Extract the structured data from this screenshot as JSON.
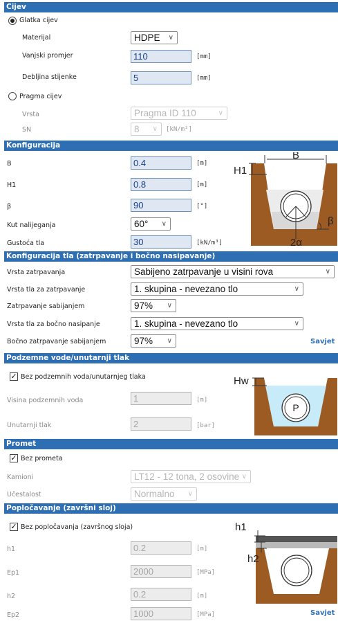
{
  "sections": {
    "cijev": "Cijev",
    "konfiguracija": "Konfiguracija",
    "konfiguracija_tla": "Konfiguracija tla (zatrpavanje i bočno nasipavanje)",
    "podzemne_vode": "Podzemne vode/unutarnji tlak",
    "promet": "Promet",
    "poplocavanje": "Popločavanje (završni sloj)"
  },
  "cijev": {
    "glatka_label": "Glatka cijev",
    "materijal_label": "Materijal",
    "materijal_value": "HDPE",
    "vanjski_promjer_label": "Vanjski promjer",
    "vanjski_promjer_value": "110",
    "vanjski_promjer_unit": "[mm]",
    "debljina_label": "Debljina stijenke",
    "debljina_value": "5",
    "debljina_unit": "[mm]",
    "pragma_label": "Pragma cijev",
    "vrsta_label": "Vrsta",
    "vrsta_value": "Pragma ID 110",
    "sn_label": "SN",
    "sn_value": "8",
    "sn_unit": "[kN/m²]",
    "glatka_selected": true
  },
  "konfiguracija": {
    "b_label": "B",
    "b_value": "0.4",
    "b_unit": "[m]",
    "h1_label": "H1",
    "h1_value": "0.8",
    "h1_unit": "[m]",
    "beta_label": "β",
    "beta_value": "90",
    "beta_unit": "[°]",
    "kut_label": "Kut nalijeganja",
    "kut_value": "60°",
    "gustoca_label": "Gustoća tla",
    "gustoca_value": "30",
    "gustoca_unit": "[kN/m³]",
    "diagram_b": "B",
    "diagram_h1": "H1",
    "diagram_beta": "β",
    "diagram_alpha": "2α"
  },
  "tlo": {
    "vrsta_zatrpavanja_label": "Vrsta zatrpavanja",
    "vrsta_zatrpavanja_value": "Sabijeno zatrpavanje u visini rova",
    "vrsta_tla_zatrp_label": "Vrsta tla za zatrpavanje",
    "vrsta_tla_zatrp_value": "1. skupina - nevezano tlo",
    "zatrp_sabij_label": "Zatrpavanje sabijanjem",
    "zatrp_sabij_value": "97%",
    "vrsta_tla_bocno_label": "Vrsta tla za bočno nasipanje",
    "vrsta_tla_bocno_value": "1. skupina - nevezano tlo",
    "bocno_label": "Bočno zatrpavanje sabijanjem",
    "bocno_value": "97%",
    "savjet": "Savjet"
  },
  "voda": {
    "bez_label": "Bez podzemnih voda/unutarnjeg tlaka",
    "bez_checked": true,
    "visina_label": "Visina podzemnih voda",
    "visina_value": "1",
    "visina_unit": "[m]",
    "tlak_label": "Unutarnji tlak",
    "tlak_value": "2",
    "tlak_unit": "[bar]",
    "diagram_hw": "Hw",
    "diagram_p": "P"
  },
  "promet": {
    "bez_label": "Bez prometa",
    "bez_checked": true,
    "kamioni_label": "Kamioni",
    "kamioni_value": "LT12 - 12 tona, 2 osovine",
    "ucestalost_label": "Učestalost",
    "ucestalost_value": "Normalno"
  },
  "poplocavanje": {
    "bez_label": "Bez popločavanja (završnog sloja)",
    "bez_checked": true,
    "h1_label": "h1",
    "h1_value": "0.2",
    "h1_unit": "[m]",
    "ep1_label": "Ep1",
    "ep1_value": "2000",
    "ep1_unit": "[MPa]",
    "h2_label": "h2",
    "h2_value": "0.2",
    "h2_unit": "[m]",
    "ep2_label": "Ep2",
    "ep2_value": "1000",
    "ep2_unit": "[MPa]",
    "diagram_h1": "h1",
    "diagram_h2": "h2",
    "savjet": "Savjet"
  },
  "icons": {
    "select_arrow": "chevron-down-icon",
    "check": "check-icon"
  },
  "colors": {
    "header_bg": "#2e6fb3",
    "input_bg": "#dfe7f2",
    "input_text": "#1a3f87",
    "soil_brown": "#9c5b22",
    "water_blue": "#c7ebf8"
  }
}
